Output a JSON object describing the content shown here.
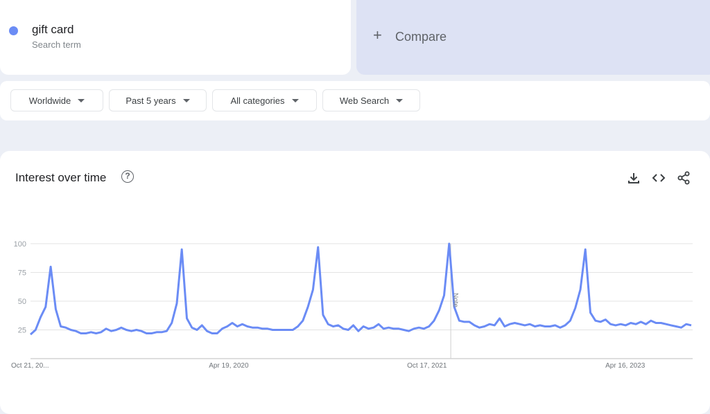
{
  "term": {
    "name": "gift card",
    "subtitle": "Search term",
    "color": "#6b8cf5"
  },
  "compare": {
    "icon": "plus-icon",
    "label": "Compare"
  },
  "filters": [
    {
      "label": "Worldwide"
    },
    {
      "label": "Past 5 years"
    },
    {
      "label": "All categories"
    },
    {
      "label": "Web Search"
    }
  ],
  "chart_card": {
    "title": "Interest over time",
    "help_icon": "?",
    "actions": [
      "download-icon",
      "embed-icon",
      "share-icon"
    ]
  },
  "chart_data": {
    "type": "line",
    "title": "Interest over time",
    "ylim": [
      0,
      100
    ],
    "yticks": [
      25,
      50,
      75,
      100
    ],
    "xtick_labels": [
      "Oct 21, 20...",
      "Apr 19, 2020",
      "Oct 17, 2021",
      "Apr 16, 2023"
    ],
    "xtick_positions": [
      0,
      0.3,
      0.6,
      0.9
    ],
    "note": {
      "label": "Note",
      "position": 0.636
    },
    "grid": true,
    "series": [
      {
        "name": "gift card",
        "color": "#6b8cf5",
        "values": [
          21,
          25,
          36,
          45,
          80,
          43,
          28,
          27,
          25,
          24,
          22,
          22,
          23,
          22,
          23,
          26,
          24,
          25,
          27,
          25,
          24,
          25,
          24,
          22,
          22,
          23,
          23,
          24,
          31,
          48,
          95,
          35,
          27,
          25,
          29,
          24,
          22,
          22,
          26,
          28,
          31,
          28,
          30,
          28,
          27,
          27,
          26,
          26,
          25,
          25,
          25,
          25,
          25,
          28,
          33,
          45,
          60,
          97,
          38,
          30,
          28,
          29,
          26,
          25,
          29,
          24,
          28,
          26,
          27,
          30,
          26,
          27,
          26,
          26,
          25,
          24,
          26,
          27,
          26,
          28,
          33,
          42,
          55,
          100,
          45,
          33,
          32,
          32,
          29,
          27,
          28,
          30,
          29,
          35,
          28,
          30,
          31,
          30,
          29,
          30,
          28,
          29,
          28,
          28,
          29,
          27,
          29,
          33,
          44,
          60,
          95,
          40,
          33,
          32,
          34,
          30,
          29,
          30,
          29,
          31,
          30,
          32,
          30,
          33,
          31,
          31,
          30,
          29,
          28,
          27,
          30,
          29
        ]
      }
    ]
  }
}
